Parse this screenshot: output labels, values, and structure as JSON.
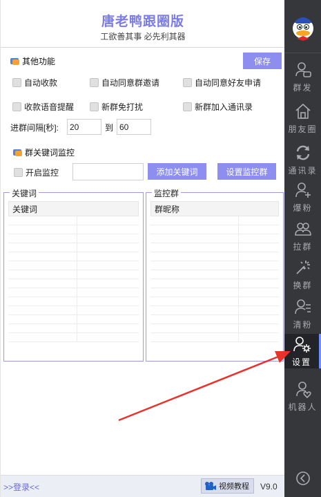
{
  "app": {
    "title": "唐老鸭跟圈版",
    "subtitle": "工欲善其事 必先利其器"
  },
  "other_functions": {
    "title": "其他功能",
    "save_label": "保存",
    "checkboxes": [
      {
        "label": "自动收款",
        "checked": false
      },
      {
        "label": "自动同意群邀请",
        "checked": false
      },
      {
        "label": "自动同意好友申请",
        "checked": false
      },
      {
        "label": "收款语音提醒",
        "checked": false
      },
      {
        "label": "新群免打扰",
        "checked": false
      },
      {
        "label": "新群加入通讯录",
        "checked": false
      }
    ],
    "interval_label": "进群间隔[秒]:",
    "interval_from": "20",
    "to_label": "到",
    "interval_to": "60"
  },
  "keyword_monitor": {
    "title": "群关键词监控",
    "enable_label": "开启监控",
    "enable_checked": false,
    "keyword_input_value": "",
    "add_keyword_label": "添加关键词",
    "set_group_label": "设置监控群"
  },
  "keyword_panel": {
    "title": "关键词",
    "column": "关键词",
    "rows": []
  },
  "monitor_panel": {
    "title": "监控群",
    "column": "群昵称",
    "rows": []
  },
  "status_bar": {
    "login_label": ">>登录<<",
    "video_label": "视频教程",
    "version": "V9.0"
  },
  "sidebar": {
    "items": [
      {
        "label": "群发",
        "icon": "person-chat-icon"
      },
      {
        "label": "朋友圈",
        "icon": "home-icon"
      },
      {
        "label": "通讯录",
        "icon": "sync-icon"
      },
      {
        "label": "爆粉",
        "icon": "add-person-icon"
      },
      {
        "label": "拉群",
        "icon": "group-icon"
      },
      {
        "label": "换群",
        "icon": "sparkle-icon"
      },
      {
        "label": "清粉",
        "icon": "person-list-icon"
      },
      {
        "label": "设置",
        "icon": "person-gear-icon",
        "active": true
      },
      {
        "label": "机器人",
        "icon": "person-heart-icon"
      }
    ]
  },
  "colors": {
    "accent": "#8e8ef0",
    "title": "#7b7be6",
    "sidebar_bg": "#35373b",
    "arrow": "#e8322c"
  }
}
